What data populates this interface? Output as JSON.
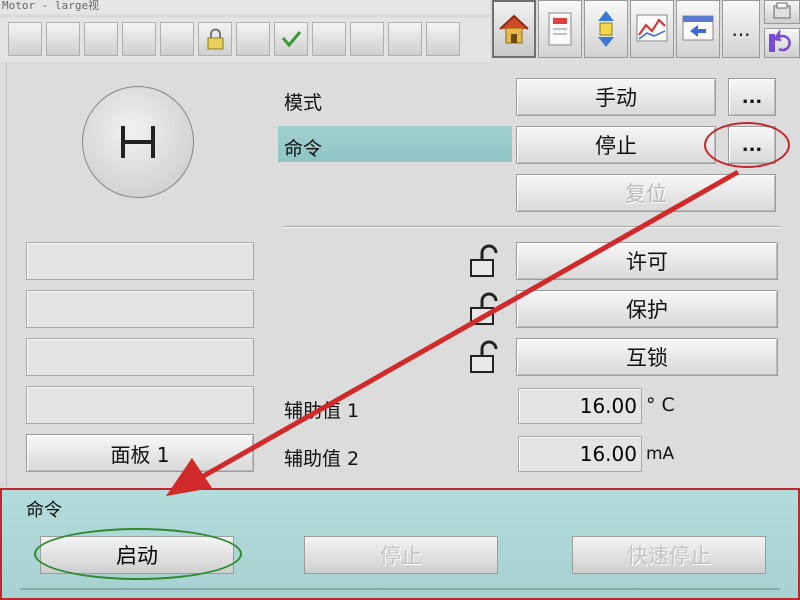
{
  "window": {
    "title": "Motor - large视"
  },
  "toolbar": {
    "tab_icons": [
      "home-icon",
      "faceplate-icon",
      "parameter-icon",
      "trend-icon",
      "alarm-icon",
      "more-icon"
    ],
    "more_label": "...",
    "side_icons": [
      "print-icon",
      "undo-icon"
    ]
  },
  "status": {
    "motor_symbol": "H"
  },
  "mode": {
    "label": "模式",
    "value": "手动",
    "more": "..."
  },
  "command": {
    "label": "命令",
    "value": "停止",
    "more": "..."
  },
  "reset": {
    "label": "复位"
  },
  "interlocks": [
    {
      "label": "许可"
    },
    {
      "label": "保护"
    },
    {
      "label": "互锁"
    }
  ],
  "aux": [
    {
      "label": "辅助值 1",
      "value": "16.00",
      "unit": "° C"
    },
    {
      "label": "辅助值 2",
      "value": "16.00",
      "unit": "mA"
    }
  ],
  "panel": {
    "label": "面板 1"
  },
  "command_panel": {
    "title": "命令",
    "start": "启动",
    "stop": "停止",
    "quick_stop": "快速停止"
  },
  "colors": {
    "highlight": "#c0282a",
    "start_ring": "#2d8a2d",
    "teal_bar": "#a8d2d2"
  }
}
